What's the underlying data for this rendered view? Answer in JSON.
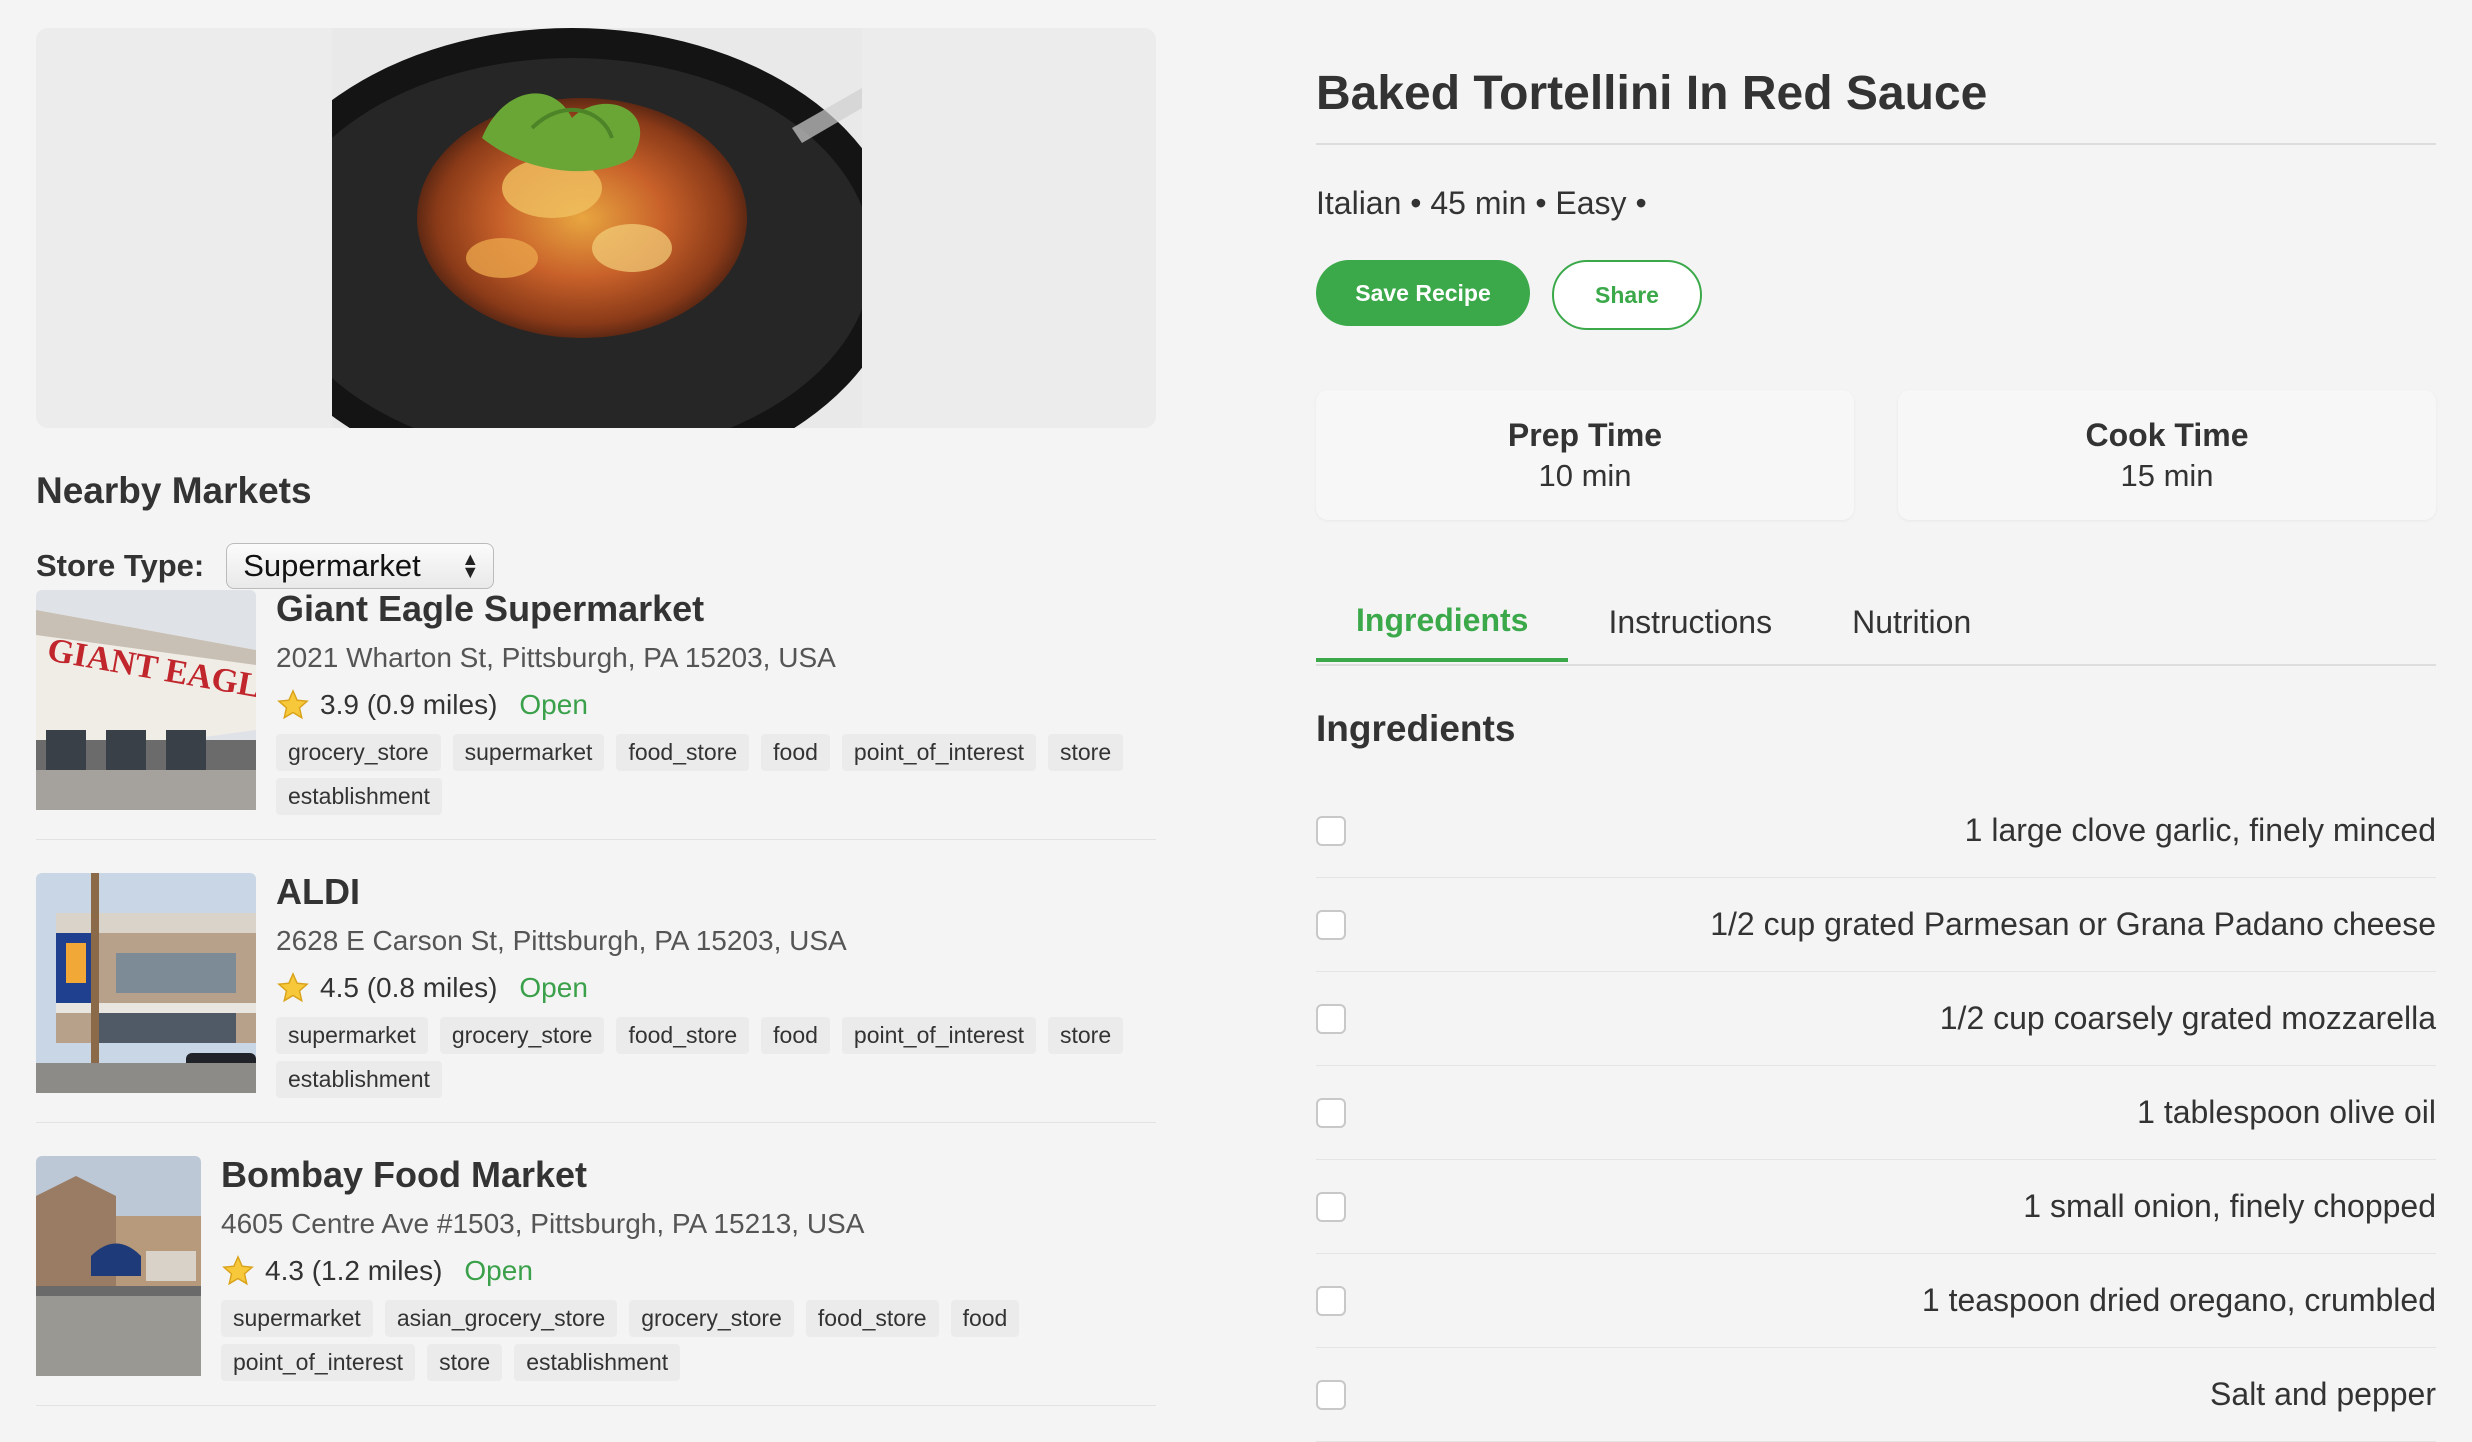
{
  "recipe": {
    "title": "Baked Tortellini In Red Sauce",
    "meta": "Italian • 45 min • Easy •",
    "save_label": "Save Recipe",
    "share_label": "Share",
    "prep_label": "Prep Time",
    "prep_value": "10 min",
    "cook_label": "Cook Time",
    "cook_value": "15 min",
    "tabs": [
      {
        "label": "Ingredients",
        "active": true
      },
      {
        "label": "Instructions",
        "active": false
      },
      {
        "label": "Nutrition",
        "active": false
      }
    ],
    "ingredients_heading": "Ingredients",
    "ingredients": [
      "1 large clove garlic, finely minced",
      "1/2 cup grated Parmesan or Grana Padano cheese",
      "1/2 cup coarsely grated mozzarella",
      "1 tablespoon olive oil",
      "1 small onion, finely chopped",
      "1 teaspoon dried oregano, crumbled",
      "Salt and pepper"
    ]
  },
  "markets": {
    "title": "Nearby Markets",
    "store_type_label": "Store Type:",
    "store_type_value": "Supermarket",
    "items": [
      {
        "name": "Giant Eagle Supermarket",
        "address": "2021 Wharton St, Pittsburgh, PA 15203, USA",
        "rating_text": "3.9 (0.9 miles)",
        "status": "Open",
        "tags": [
          "grocery_store",
          "supermarket",
          "food_store",
          "food",
          "point_of_interest",
          "store",
          "establishment"
        ]
      },
      {
        "name": "ALDI",
        "address": "2628 E Carson St, Pittsburgh, PA 15203, USA",
        "rating_text": "4.5 (0.8 miles)",
        "status": "Open",
        "tags": [
          "supermarket",
          "grocery_store",
          "food_store",
          "food",
          "point_of_interest",
          "store",
          "establishment"
        ]
      },
      {
        "name": "Bombay Food Market",
        "address": "4605 Centre Ave #1503, Pittsburgh, PA 15213, USA",
        "rating_text": "4.3 (1.2 miles)",
        "status": "Open",
        "tags": [
          "supermarket",
          "asian_grocery_store",
          "grocery_store",
          "food_store",
          "food",
          "point_of_interest",
          "store",
          "establishment"
        ]
      }
    ]
  },
  "colors": {
    "accent": "#3ba94a",
    "open": "#3aa04a"
  },
  "icons": {
    "star": "star-icon",
    "select": "chevron-updown-icon"
  }
}
